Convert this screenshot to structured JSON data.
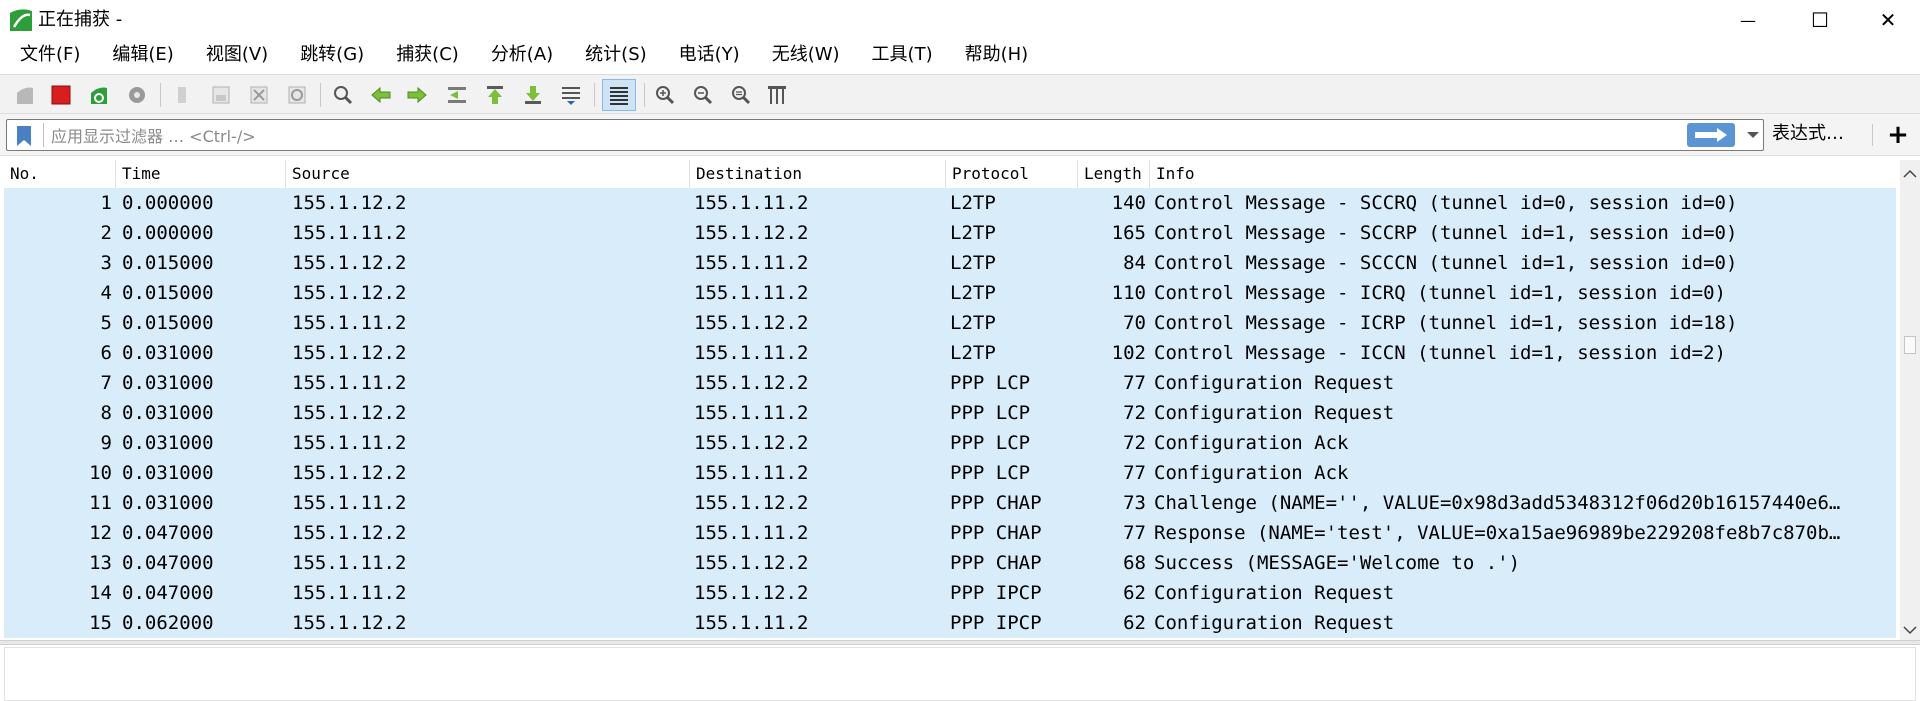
{
  "window": {
    "title": "正在捕获 -",
    "minimize_glyph": "—",
    "maximize_glyph": "☐",
    "close_glyph": "✕"
  },
  "menu": {
    "items": [
      {
        "label": "文件(F)"
      },
      {
        "label": "编辑(E)"
      },
      {
        "label": "视图(V)"
      },
      {
        "label": "跳转(G)"
      },
      {
        "label": "捕获(C)"
      },
      {
        "label": "分析(A)"
      },
      {
        "label": "统计(S)"
      },
      {
        "label": "电话(Y)"
      },
      {
        "label": "无线(W)"
      },
      {
        "label": "工具(T)"
      },
      {
        "label": "帮助(H)"
      }
    ]
  },
  "toolbar": {
    "icons": [
      "start-capture-icon",
      "stop-capture-icon",
      "restart-capture-icon",
      "capture-options-icon",
      "open-file-icon",
      "save-file-icon",
      "close-file-icon",
      "reload-file-icon",
      "find-packet-icon",
      "go-back-icon",
      "go-forward-icon",
      "go-to-packet-icon",
      "first-packet-icon",
      "last-packet-icon",
      "autoscroll-icon",
      "colorize-icon",
      "zoom-in-icon",
      "zoom-out-icon",
      "normal-size-icon",
      "resize-columns-icon"
    ]
  },
  "filter": {
    "placeholder": "应用显示过滤器 … <Ctrl-/>",
    "value": "",
    "expression_label": "表达式…",
    "add_label": "+"
  },
  "packet_list": {
    "columns": [
      "No.",
      "Time",
      "Source",
      "Destination",
      "Protocol",
      "Length",
      "Info"
    ],
    "rows": [
      {
        "no": "1",
        "time": "0.000000",
        "source": "155.1.12.2",
        "destination": "155.1.11.2",
        "protocol": "L2TP",
        "length": "140",
        "info": "Control Message - SCCRQ (tunnel id=0, session id=0)"
      },
      {
        "no": "2",
        "time": "0.000000",
        "source": "155.1.11.2",
        "destination": "155.1.12.2",
        "protocol": "L2TP",
        "length": "165",
        "info": "Control Message - SCCRP (tunnel id=1, session id=0)"
      },
      {
        "no": "3",
        "time": "0.015000",
        "source": "155.1.12.2",
        "destination": "155.1.11.2",
        "protocol": "L2TP",
        "length": "84",
        "info": "Control Message - SCCCN (tunnel id=1, session id=0)"
      },
      {
        "no": "4",
        "time": "0.015000",
        "source": "155.1.12.2",
        "destination": "155.1.11.2",
        "protocol": "L2TP",
        "length": "110",
        "info": "Control Message - ICRQ (tunnel id=1, session id=0)"
      },
      {
        "no": "5",
        "time": "0.015000",
        "source": "155.1.11.2",
        "destination": "155.1.12.2",
        "protocol": "L2TP",
        "length": "70",
        "info": "Control Message - ICRP (tunnel id=1, session id=18)"
      },
      {
        "no": "6",
        "time": "0.031000",
        "source": "155.1.12.2",
        "destination": "155.1.11.2",
        "protocol": "L2TP",
        "length": "102",
        "info": "Control Message - ICCN (tunnel id=1, session id=2)"
      },
      {
        "no": "7",
        "time": "0.031000",
        "source": "155.1.11.2",
        "destination": "155.1.12.2",
        "protocol": "PPP LCP",
        "length": "77",
        "info": "Configuration Request"
      },
      {
        "no": "8",
        "time": "0.031000",
        "source": "155.1.12.2",
        "destination": "155.1.11.2",
        "protocol": "PPP LCP",
        "length": "72",
        "info": "Configuration Request"
      },
      {
        "no": "9",
        "time": "0.031000",
        "source": "155.1.11.2",
        "destination": "155.1.12.2",
        "protocol": "PPP LCP",
        "length": "72",
        "info": "Configuration Ack"
      },
      {
        "no": "10",
        "time": "0.031000",
        "source": "155.1.12.2",
        "destination": "155.1.11.2",
        "protocol": "PPP LCP",
        "length": "77",
        "info": "Configuration Ack"
      },
      {
        "no": "11",
        "time": "0.031000",
        "source": "155.1.11.2",
        "destination": "155.1.12.2",
        "protocol": "PPP CHAP",
        "length": "73",
        "info": "Challenge (NAME='', VALUE=0x98d3add5348312f06d20b16157440e6…"
      },
      {
        "no": "12",
        "time": "0.047000",
        "source": "155.1.12.2",
        "destination": "155.1.11.2",
        "protocol": "PPP CHAP",
        "length": "77",
        "info": "Response (NAME='test', VALUE=0xa15ae96989be229208fe8b7c870b…"
      },
      {
        "no": "13",
        "time": "0.047000",
        "source": "155.1.11.2",
        "destination": "155.1.12.2",
        "protocol": "PPP CHAP",
        "length": "68",
        "info": "Success (MESSAGE='Welcome to .')"
      },
      {
        "no": "14",
        "time": "0.047000",
        "source": "155.1.11.2",
        "destination": "155.1.12.2",
        "protocol": "PPP IPCP",
        "length": "62",
        "info": "Configuration Request"
      },
      {
        "no": "15",
        "time": "0.062000",
        "source": "155.1.12.2",
        "destination": "155.1.11.2",
        "protocol": "PPP IPCP",
        "length": "62",
        "info": "Configuration Request"
      }
    ]
  },
  "colors": {
    "row_background": "#d9ecfa",
    "stop_red": "#d81e1e",
    "shark_green": "#2e9e3a",
    "apply_blue": "#5b95d6"
  }
}
